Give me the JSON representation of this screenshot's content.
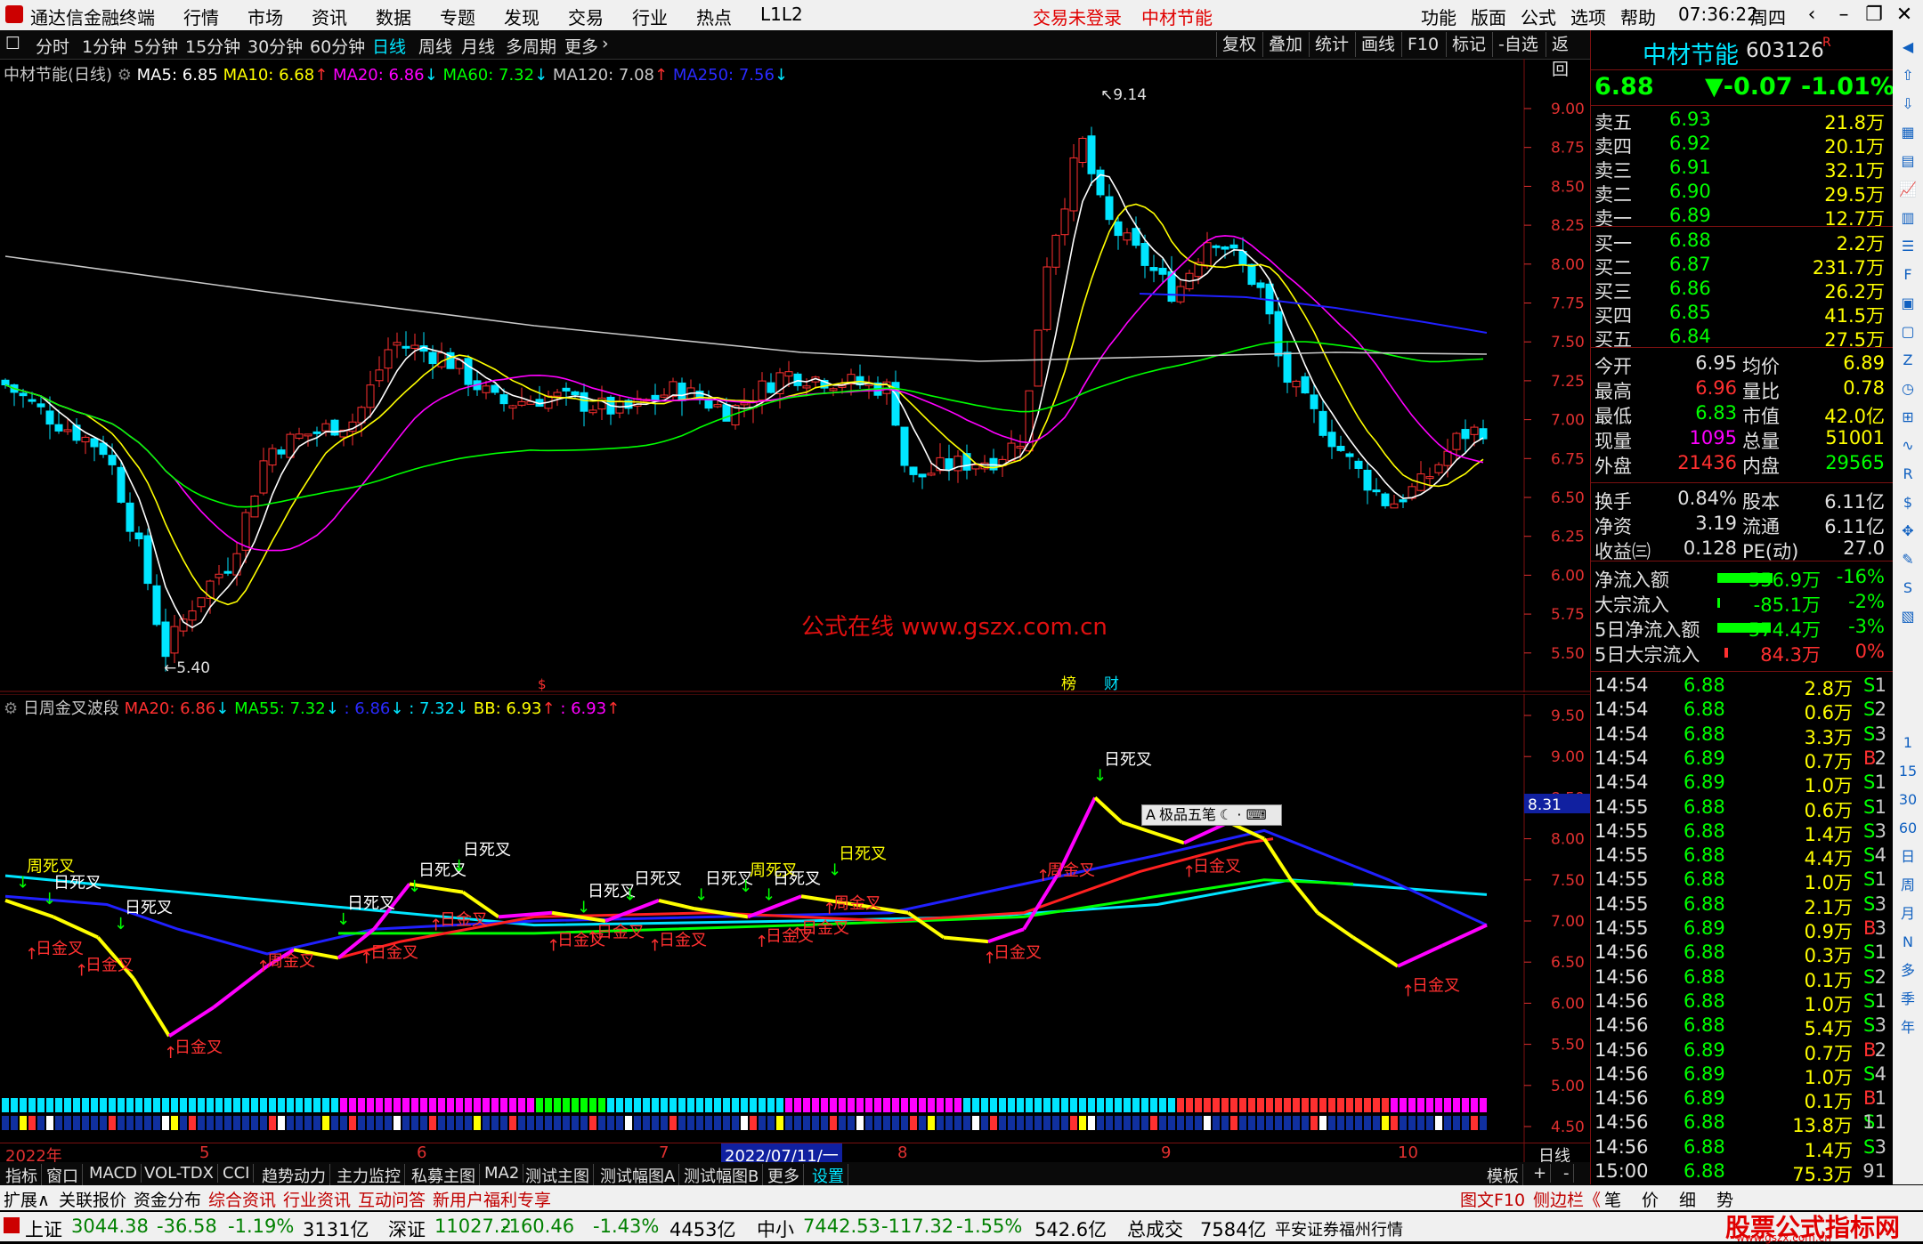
{
  "titlebar": {
    "app": "通达信金融终端",
    "menus": [
      "行情",
      "市场",
      "资讯",
      "数据",
      "专题",
      "发现",
      "交易",
      "行业",
      "热点",
      "L1L2"
    ],
    "center_status": "交易未登录",
    "center_stock": "中材节能",
    "right_menus": [
      "功能",
      "版面",
      "公式",
      "选项",
      "帮助"
    ],
    "time": "07:36:22",
    "weekday": "周四"
  },
  "periods": [
    "分时",
    "1分钟",
    "5分钟",
    "15分钟",
    "30分钟",
    "60分钟",
    "日线",
    "周线",
    "月线",
    "多周期",
    "更多"
  ],
  "active_period": "日线",
  "tools": [
    "复权",
    "叠加",
    "统计",
    "画线",
    "F10",
    "标记",
    "-自选",
    "返回"
  ],
  "main_legend": {
    "name": "中材节能(日线)",
    "ma5": "MA5: 6.85",
    "ma10": "MA10: 6.68",
    "ma20": "MA20: 6.86",
    "ma60": "MA60: 7.32",
    "ma120": "MA120: 7.08",
    "ma250": "MA250: 7.56"
  },
  "main_axis": [
    "9.00",
    "8.75",
    "8.50",
    "8.25",
    "8.00",
    "7.75",
    "7.50",
    "7.25",
    "7.00",
    "6.75",
    "6.50",
    "6.25",
    "6.00",
    "5.75",
    "5.50"
  ],
  "main_high_label": "9.14",
  "main_low_label": "5.40",
  "watermark": "公式在线  www.gszx.com.cn",
  "markers": {
    "bang": "榜",
    "cai": "财",
    "dollar": "$"
  },
  "sub_legend": {
    "name": "日周金叉波段",
    "ma20": "MA20: 6.86",
    "ma55": "MA55: 7.32",
    "v1": ": 6.86",
    "v2": ": 7.32",
    "bb": "BB: 6.93",
    "v3": ": 6.93"
  },
  "sub_axis": [
    "9.50",
    "9.00",
    "8.50",
    "8.00",
    "7.50",
    "7.00",
    "6.50",
    "6.00",
    "5.50",
    "5.00",
    "4.50"
  ],
  "sub_price_tag": "8.31",
  "sub_labels": {
    "rsc": "日死叉",
    "rjc": "日金叉",
    "zsc": "周死叉",
    "zjc": "周金叉"
  },
  "float_tool": "极品五笔",
  "date_axis": {
    "year": "2022年",
    "m5": "5",
    "m6": "6",
    "m7": "7",
    "cursor": "2022/07/11/一",
    "m8": "8",
    "m9": "9",
    "m10": "10",
    "period": "日线"
  },
  "sub_tabs": [
    "指标",
    "窗口",
    "MACD",
    "VOL-TDX",
    "CCI",
    "趋势动力",
    "主力监控",
    "私募主图",
    "MA2",
    "测试主图",
    "测试幅图A",
    "测试幅图B",
    "更多",
    "设置"
  ],
  "right_tabs": [
    "模板",
    "+",
    "-"
  ],
  "infobar": [
    "扩展∧",
    "关联报价",
    "资金分布",
    "综合资讯",
    "行业资讯",
    "互动问答",
    "新用户福利专享"
  ],
  "infobar_right": [
    "图文F10",
    "侧边栏《",
    "笔",
    "价",
    "细",
    "势"
  ],
  "quote": {
    "name": "中材节能",
    "code": "603126",
    "flag": "R",
    "price": "6.88",
    "change": "▼-0.07",
    "pct": "-1.01%",
    "asks": [
      [
        "卖五",
        "6.93",
        "21.8万"
      ],
      [
        "卖四",
        "6.92",
        "20.1万"
      ],
      [
        "卖三",
        "6.91",
        "32.1万"
      ],
      [
        "卖二",
        "6.90",
        "29.5万"
      ],
      [
        "卖一",
        "6.89",
        "12.7万"
      ]
    ],
    "bids": [
      [
        "买一",
        "6.88",
        "2.2万"
      ],
      [
        "买二",
        "6.87",
        "231.7万"
      ],
      [
        "买三",
        "6.86",
        "26.2万"
      ],
      [
        "买四",
        "6.85",
        "41.5万"
      ],
      [
        "买五",
        "6.84",
        "27.5万"
      ]
    ],
    "stats": [
      [
        "今开",
        "6.95",
        "均价",
        "6.89"
      ],
      [
        "最高",
        "6.96",
        "量比",
        "0.78"
      ],
      [
        "最低",
        "6.83",
        "市值",
        "42.0亿"
      ],
      [
        "现量",
        "1095",
        "总量",
        "51001"
      ],
      [
        "外盘",
        "21436",
        "内盘",
        "29565"
      ]
    ],
    "stats2": [
      [
        "换手",
        "0.84%",
        "股本",
        "6.11亿"
      ],
      [
        "净资",
        "3.19",
        "流通",
        "6.11亿"
      ],
      [
        "收益㈢",
        "0.128",
        "PE(动)",
        "27.0"
      ]
    ],
    "flows": [
      [
        "净流入额",
        "-556.9万",
        "-16%"
      ],
      [
        "大宗流入",
        "-85.1万",
        "-2%"
      ],
      [
        "5日净流入额",
        "-574.4万",
        "-3%"
      ],
      [
        "5日大宗流入",
        "84.3万",
        "0%"
      ]
    ],
    "ticks": [
      [
        "14:54",
        "6.88",
        "2.8万",
        "S",
        "1"
      ],
      [
        "14:54",
        "6.88",
        "0.6万",
        "S",
        "2"
      ],
      [
        "14:54",
        "6.88",
        "3.3万",
        "S",
        "3"
      ],
      [
        "14:54",
        "6.89",
        "0.7万",
        "B",
        "2"
      ],
      [
        "14:54",
        "6.89",
        "1.0万",
        "S",
        "1"
      ],
      [
        "14:55",
        "6.88",
        "0.6万",
        "S",
        "1"
      ],
      [
        "14:55",
        "6.88",
        "1.4万",
        "S",
        "3"
      ],
      [
        "14:55",
        "6.88",
        "4.4万",
        "S",
        "4"
      ],
      [
        "14:55",
        "6.88",
        "1.0万",
        "S",
        "1"
      ],
      [
        "14:55",
        "6.88",
        "2.1万",
        "S",
        "3"
      ],
      [
        "14:55",
        "6.89",
        "0.9万",
        "B",
        "3"
      ],
      [
        "14:56",
        "6.88",
        "0.3万",
        "S",
        "1"
      ],
      [
        "14:56",
        "6.88",
        "0.1万",
        "S",
        "2"
      ],
      [
        "14:56",
        "6.88",
        "1.0万",
        "S",
        "1"
      ],
      [
        "14:56",
        "6.88",
        "5.4万",
        "S",
        "3"
      ],
      [
        "14:56",
        "6.89",
        "0.7万",
        "B",
        "2"
      ],
      [
        "14:56",
        "6.89",
        "1.0万",
        "S",
        "4"
      ],
      [
        "14:56",
        "6.89",
        "0.1万",
        "B",
        "1"
      ],
      [
        "14:56",
        "6.88",
        "13.8万",
        "S",
        "11"
      ],
      [
        "14:56",
        "6.88",
        "1.4万",
        "S",
        "3"
      ],
      [
        "15:00",
        "6.88",
        "75.3万",
        "",
        "91"
      ]
    ]
  },
  "index_bar": [
    {
      "name": "上证",
      "val": "3044.38",
      "chg": "-36.58",
      "pct": "-1.19%",
      "amt": "3131亿"
    },
    {
      "name": "深证",
      "val": "11027.2",
      "chg": "-160.46",
      "pct": "-1.43%",
      "amt": "4453亿"
    },
    {
      "name": "中小",
      "val": "7442.53",
      "chg": "-117.32",
      "pct": "-1.55%",
      "amt": "542.6亿"
    },
    {
      "name": "总成交",
      "val": "7584亿",
      "chg": "",
      "pct": "",
      "amt": ""
    }
  ],
  "broker": "平安证券福州行情",
  "brand": "股票公式指标网",
  "brand_url": "www.gszx.com.cn",
  "side_icons": [
    "1",
    "15",
    "30",
    "60",
    "日",
    "周",
    "月",
    "N",
    "多",
    "季",
    "年"
  ],
  "colors": {
    "up": "#ff3030",
    "down": "#00e5ff",
    "ma5": "#ffffff",
    "ma10": "#ffff00",
    "ma20": "#ff00ff",
    "ma60": "#00ff00",
    "ma120": "#c8c8c8",
    "ma250": "#2020ff",
    "fall": "#00ff00"
  }
}
